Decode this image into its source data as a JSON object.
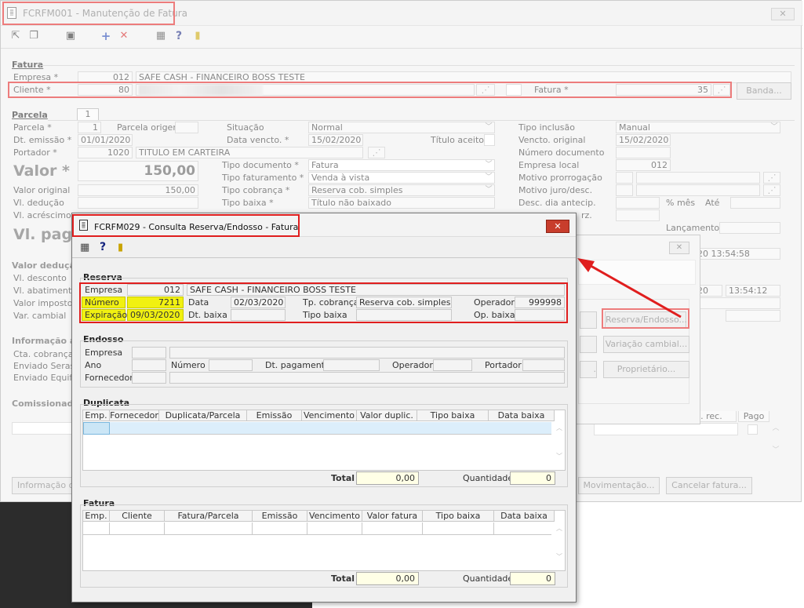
{
  "main": {
    "title": "FCRFM001 - Manutenção de Fatura",
    "fatura_section": "Fatura",
    "empresa_label": "Empresa *",
    "empresa_code": "012",
    "empresa_name": "SAFE CASH - FINANCEIRO BOSS TESTE",
    "cliente_label": "Cliente *",
    "cliente_code": "80",
    "fatura_label": "Fatura *",
    "fatura_value": "35",
    "banda_btn": "Banda...",
    "parcela_section": "Parcela",
    "parcela_tab": "1",
    "left": {
      "parcela_label": "Parcela *",
      "parcela_value": "1",
      "parcela_origem_label": "Parcela origem",
      "dt_emissao_label": "Dt. emissão *",
      "dt_emissao_value": "01/01/2020",
      "portador_label": "Portador *",
      "portador_code": "1020",
      "portador_name": "TITULO EM CARTEIRA",
      "valor_label": "Valor *",
      "valor_value": "150,00",
      "valor_original_label": "Valor original",
      "valor_original_value": "150,00",
      "vl_deducao_label": "Vl. dedução",
      "vl_acrescimo_label": "Vl. acréscimo",
      "vl_pago_label": "Vl. pago",
      "valor_deducao_section": "Valor dedução",
      "vl_desconto_label": "Vl. desconto",
      "vl_abatimento_label": "Vl. abatimento",
      "valor_imposto_label": "Valor imposto",
      "var_cambial_label": "Var. cambial",
      "informacao_section": "Informação ad",
      "cta_cobranca_label": "Cta. cobrança",
      "enviado_serasa_label": "Enviado Serasa",
      "enviado_equifax_label": "Enviado Equifax",
      "comissionado_section": "Comissionado"
    },
    "middle": {
      "situacao_label": "Situação",
      "situacao_value": "Normal",
      "data_vencto_label": "Data vencto. *",
      "data_vencto_value": "15/02/2020",
      "titulo_aceito_label": "Título aceito",
      "tipo_documento_label": "Tipo documento *",
      "tipo_documento_value": "Fatura",
      "tipo_faturamento_label": "Tipo faturamento *",
      "tipo_faturamento_value": "Venda à vista",
      "tipo_cobranca_label": "Tipo cobrança *",
      "tipo_cobranca_value": "Reserva cob. simples",
      "tipo_baixa_label": "Tipo baixa *",
      "tipo_baixa_value": "Título não baixado"
    },
    "right": {
      "tipo_inclusao_label": "Tipo inclusão",
      "tipo_inclusao_value": "Manual",
      "vencto_original_label": "Vencto. original",
      "vencto_original_value": "15/02/2020",
      "numero_documento_label": "Número documento",
      "empresa_local_label": "Empresa local",
      "empresa_local_value": "012",
      "motivo_prorrogacao_label": "Motivo prorrogação",
      "motivo_juro_label": "Motivo juro/desc.",
      "desc_dia_label": "Desc. dia antecip.",
      "pct_mes_label": "% mês",
      "ate_label": "Até",
      "rz_label": "rz.",
      "lancamento_label": "Lançamento",
      "time1": "20 13:54:58",
      "time2a": "20",
      "time2b": "13:54:12",
      "pagto_rec_label": "is. rec.",
      "pago_label": "Pago"
    },
    "buttons": {
      "reserva_endosso": "Reserva/Endosso...",
      "variacao_cambial": "Variação cambial...",
      "proprietario": "Proprietário...",
      "informacao_ori": "Informação ori",
      "movimentacao": "Movimentação...",
      "cancelar_fatura": "Cancelar fatura..."
    },
    "close": "✕"
  },
  "dialog": {
    "title": "FCRFM029 - Consulta Reserva/Endosso - Fatura",
    "reserva_section": "Reserva",
    "empresa_label": "Empresa",
    "empresa_code": "012",
    "empresa_name": "SAFE CASH - FINANCEIRO BOSS TESTE",
    "numero_label": "Número",
    "numero_value": "7211",
    "data_label": "Data",
    "data_value": "02/03/2020",
    "tp_cobranca_label": "Tp. cobrança",
    "tp_cobranca_value": "Reserva cob. simples",
    "operador_label": "Operador",
    "operador_value": "999998",
    "expiracao_label": "Expiração",
    "expiracao_value": "09/03/2020",
    "dt_baixa_label": "Dt. baixa",
    "tipo_baixa_label": "Tipo baixa",
    "op_baixa_label": "Op. baixa",
    "endosso_section": "Endosso",
    "endosso_empresa_label": "Empresa",
    "endosso_ano_label": "Ano",
    "endosso_numero_label": "Número",
    "endosso_dt_pagamento_label": "Dt. pagamento",
    "endosso_operador_label": "Operador",
    "endosso_portador_label": "Portador",
    "endosso_fornecedor_label": "Fornecedor",
    "duplicata_section": "Duplicata",
    "duplicata_headers": [
      "Emp.",
      "Fornecedor",
      "Duplicata/Parcela",
      "Emissão",
      "Vencimento",
      "Valor duplic.",
      "Tipo baixa",
      "Data baixa"
    ],
    "fatura_section": "Fatura",
    "fatura_headers": [
      "Emp.",
      "Cliente",
      "Fatura/Parcela",
      "Emissão",
      "Vencimento",
      "Valor fatura",
      "Tipo baixa",
      "Data baixa"
    ],
    "total_label": "Total",
    "total_value": "0,00",
    "quantidade_label": "Quantidade",
    "quantidade_value": "0",
    "close": "✕"
  }
}
